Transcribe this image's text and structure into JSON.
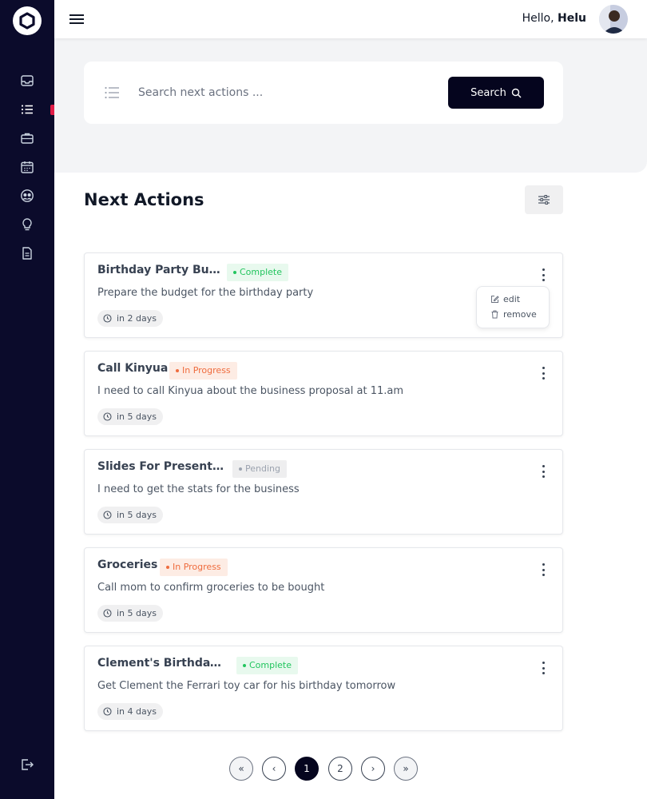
{
  "header": {
    "greeting_prefix": "Hello,",
    "user_name": "Helu"
  },
  "search": {
    "placeholder": "Search next actions ...",
    "button_label": "Search"
  },
  "main": {
    "title": "Next Actions"
  },
  "actions": [
    {
      "title": "Birthday Party Budget",
      "status": "Complete",
      "description": "Prepare the budget for the birthday party",
      "due": "in 2 days"
    },
    {
      "title": "Call Kinyua",
      "status": "In Progress",
      "description": "I need to call Kinyua about the business proposal at 11.am",
      "due": "in 5 days"
    },
    {
      "title": "Slides For Presentation",
      "status": "Pending",
      "description": "I need to get the stats for the business",
      "due": "in 5 days"
    },
    {
      "title": "Groceries",
      "status": "In Progress",
      "description": "Call mom to confirm groceries to be bought",
      "due": "in 5 days"
    },
    {
      "title": "Clement's Birthday Party",
      "status": "Complete",
      "description": "Get Clement the Ferrari toy car for his birthday tomorrow",
      "due": "in 4 days"
    }
  ],
  "card_menu": {
    "edit_label": "edit",
    "remove_label": "remove"
  },
  "pagination": {
    "first": "«",
    "prev": "‹",
    "pages": [
      "1",
      "2"
    ],
    "current": "1",
    "next": "›",
    "last": "»"
  },
  "colors": {
    "sidebar_bg": "#0b0b2b",
    "primary_button": "#05051e",
    "active_indicator": "#e11d48",
    "status_complete": "#22c55e",
    "status_in_progress": "#ef6c3e",
    "status_pending": "#9ca3af"
  }
}
